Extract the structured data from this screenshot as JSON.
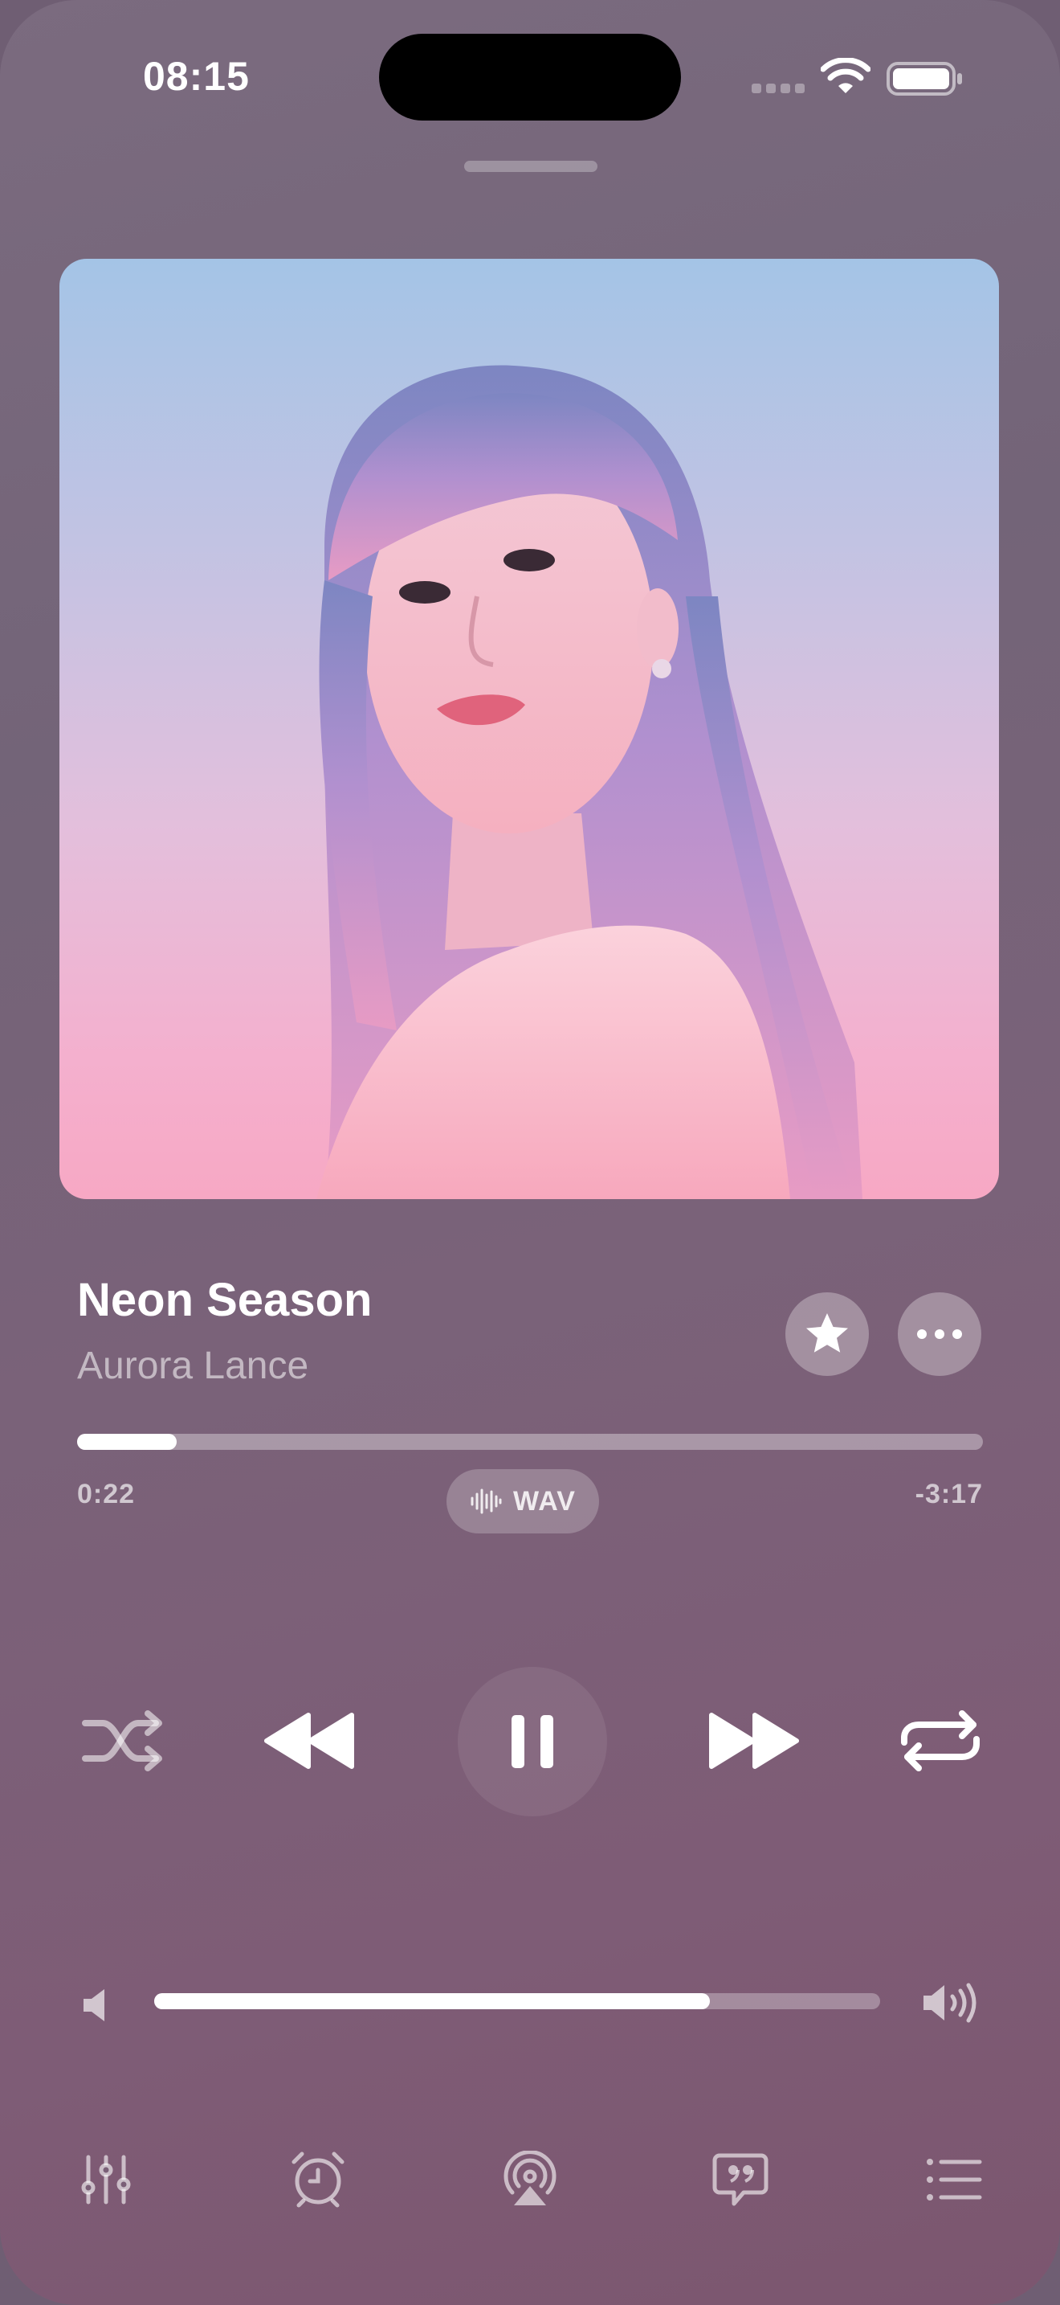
{
  "status_bar": {
    "time": "08:15"
  },
  "track": {
    "title": "Neon Season",
    "artist": "Aurora Lance",
    "artwork_icon": "album-artwork-portrait"
  },
  "progress": {
    "elapsed": "0:22",
    "remaining": "-3:17",
    "fraction": 0.11
  },
  "format_badge": {
    "label": "WAV",
    "icon": "waveform-icon"
  },
  "volume": {
    "fraction": 0.765
  },
  "transport": {
    "shuffle_icon": "shuffle-icon",
    "rewind_icon": "rewind-icon",
    "pause_icon": "pause-icon",
    "forward_icon": "fast-forward-icon",
    "repeat_icon": "repeat-icon"
  },
  "bottom_bar": [
    "equalizer-icon",
    "alarm-clock-icon",
    "airplay-icon",
    "lyrics-icon",
    "queue-icon"
  ],
  "colors": {
    "accent": "#ffffff",
    "background": "#776379"
  }
}
